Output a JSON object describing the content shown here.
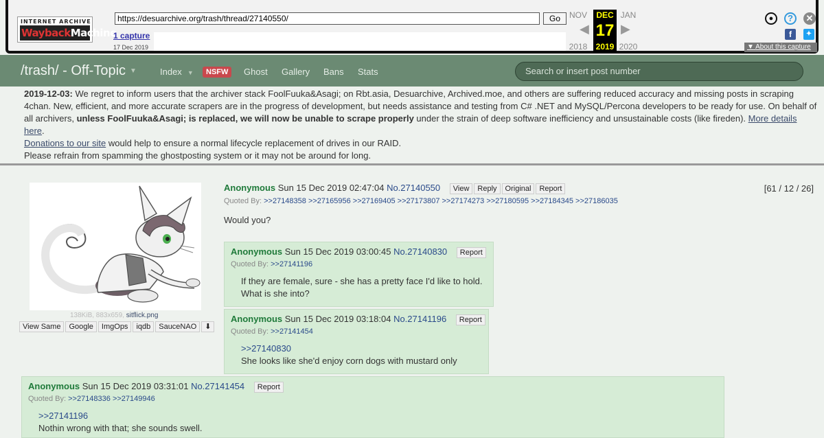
{
  "wayback": {
    "logo_top": "INTERNET ARCHIVE",
    "logo_main_a": "Wayback",
    "logo_main_b": "Machine",
    "url": "https://desuarchive.org/trash/thread/27140550/",
    "go": "Go",
    "captures": "1 capture",
    "capture_date": "17 Dec 2019",
    "prev": {
      "month": "NOV",
      "year": "2018"
    },
    "current": {
      "month": "DEC",
      "day": "17",
      "year": "2019"
    },
    "next": {
      "month": "JAN",
      "year": "2020"
    },
    "about": "About this capture"
  },
  "nav": {
    "title": "/trash/ - Off-Topic",
    "links": [
      "Index",
      "NSFW",
      "Ghost",
      "Gallery",
      "Bans",
      "Stats"
    ],
    "search_placeholder": "Search or insert post number"
  },
  "announcement": {
    "date": "2019-12-03:",
    "text1": " We regret to inform users that the archiver stack FoolFuuka&Asagi; on Rbt.asia, Desuarchive, Archived.moe, and others are suffering reduced accuracy and missing posts in scraping 4chan. New, efficient, and more accurate scrapers are in the progress of development, but needs assistance and testing from C# .NET and MySQL/Percona developers to be ready for use. On behalf of all archivers, ",
    "bold": "unless FoolFuuka&Asagi; is replaced, we will now be unable to scrape properly",
    "text2": " under the strain of deep software inefficiency and unsustainable costs (like fireden). ",
    "more_link": "More details here",
    "period": ".",
    "donate_link": "Donations to our site",
    "donate_text": " would help to ensure a normal lifecycle replacement of drives in our RAID.",
    "refrain": "Please refrain from spamming the ghostposting system or it may not be around for long."
  },
  "op": {
    "name": "Anonymous",
    "date": "Sun 15 Dec 2019 02:47:04",
    "num": "No.27140550",
    "buttons": [
      "View",
      "Reply",
      "Original",
      "Report"
    ],
    "stats": "[61 / 12 / 26]",
    "quoted_label": "Quoted By:",
    "quoted": ">>27148358 >>27165956 >>27169405 >>27173807 >>27174273 >>27180595 >>27184345 >>27186035",
    "body": "Would you?",
    "file_meta": "138KiB, 883x659,",
    "file_name": "sitflick.png",
    "img_buttons": [
      "View Same",
      "Google",
      "ImgOps",
      "iqdb",
      "SauceNAO"
    ]
  },
  "replies": [
    {
      "name": "Anonymous",
      "date": "Sun 15 Dec 2019 03:00:45",
      "num": "No.27140830",
      "report": "Report",
      "quoted_label": "Quoted By:",
      "quoted": ">>27141196",
      "line1": "If they are female, sure - she has a pretty face I'd like to hold.",
      "line2": "What is she into?"
    },
    {
      "name": "Anonymous",
      "date": "Sun 15 Dec 2019 03:18:04",
      "num": "No.27141196",
      "report": "Report",
      "quoted_label": "Quoted By:",
      "quoted": ">>27141454",
      "line1": ">>27140830",
      "line2": "She looks like she'd enjoy corn dogs with mustard only"
    },
    {
      "name": "Anonymous",
      "date": "Sun 15 Dec 2019 03:31:01",
      "num": "No.27141454",
      "report": "Report",
      "quoted_label": "Quoted By:",
      "quoted": ">>27148336 >>27149946",
      "line1": ">>27141196",
      "line2": "Nothin wrong with that; she sounds swell."
    }
  ]
}
